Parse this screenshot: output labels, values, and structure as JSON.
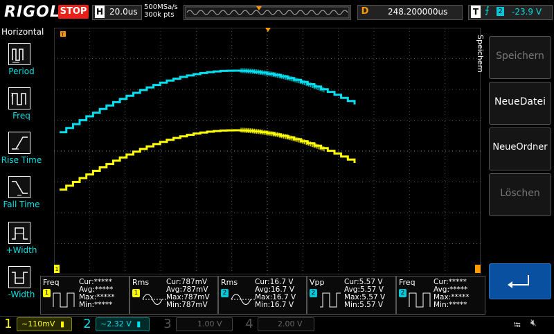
{
  "topbar": {
    "logo": "RIGOL",
    "run_state": "STOP",
    "timebase_label": "H",
    "timebase_value": "20.0us",
    "sample_rate": "500MSa/s",
    "mem_depth": "300k pts",
    "delay_label": "D",
    "delay_value": "248.200000us",
    "trigger_label": "T",
    "trigger_source": "2",
    "trigger_level": "-23.9 V"
  },
  "left_menu": {
    "title": "Horizontal",
    "items": [
      {
        "label": "Period",
        "icon": "period-icon"
      },
      {
        "label": "Freq",
        "icon": "frequency-icon"
      },
      {
        "label": "Rise Time",
        "icon": "rise-time-icon"
      },
      {
        "label": "Fall Time",
        "icon": "fall-time-icon"
      },
      {
        "label": "+Width",
        "icon": "positive-width-icon"
      },
      {
        "label": "-Width",
        "icon": "negative-width-icon"
      }
    ]
  },
  "right_menu": {
    "title": "Speichern",
    "buttons": [
      {
        "label": "Speichern",
        "enabled": false
      },
      {
        "label": "NeueDatei",
        "enabled": true
      },
      {
        "label": "NeueOrdner",
        "enabled": true
      },
      {
        "label": "Löschen",
        "enabled": false
      }
    ],
    "enter_icon": "enter-arrow-icon"
  },
  "markers": {
    "ch1_ref": "1",
    "trigger_pos": "T"
  },
  "measurements": [
    {
      "name": "Freq",
      "channel": "1",
      "cur": "Cur:*****",
      "avg": "Avg:*****",
      "max": "Max:*****",
      "min": "Min:*****"
    },
    {
      "name": "Rms",
      "channel": "1",
      "cur": "Cur:787mV",
      "avg": "Avg:787mV",
      "max": "Max:787mV",
      "min": "Min:787mV"
    },
    {
      "name": "Rms",
      "channel": "2",
      "cur": "Cur:16.7 V",
      "avg": "Avg:16.7 V",
      "max": "Max:16.7 V",
      "min": "Min:16.7 V"
    },
    {
      "name": "Vpp",
      "channel": "2",
      "cur": "Cur:5.57 V",
      "avg": "Avg:5.57 V",
      "max": "Max:5.57 V",
      "min": "Min:5.57 V"
    },
    {
      "name": "Freq",
      "channel": "2",
      "cur": "Cur:*****",
      "avg": "Avg:*****",
      "max": "Max:*****",
      "min": "Min:*****"
    }
  ],
  "channels": [
    {
      "num": "1",
      "coupling": "~",
      "scale": "110mV",
      "active": true
    },
    {
      "num": "2",
      "coupling": "~",
      "scale": "2.32 V",
      "active": true
    },
    {
      "num": "3",
      "coupling": "",
      "scale": "1.00 V",
      "active": false
    },
    {
      "num": "4",
      "coupling": "",
      "scale": "2.00 V",
      "active": false
    }
  ],
  "status_icons": [
    "usb-icon",
    "speaker-muted-icon"
  ],
  "colors": {
    "ch1": "#ffff00",
    "ch2": "#00e0f0",
    "trigger": "#ff9900",
    "stop": "#e8201a"
  }
}
